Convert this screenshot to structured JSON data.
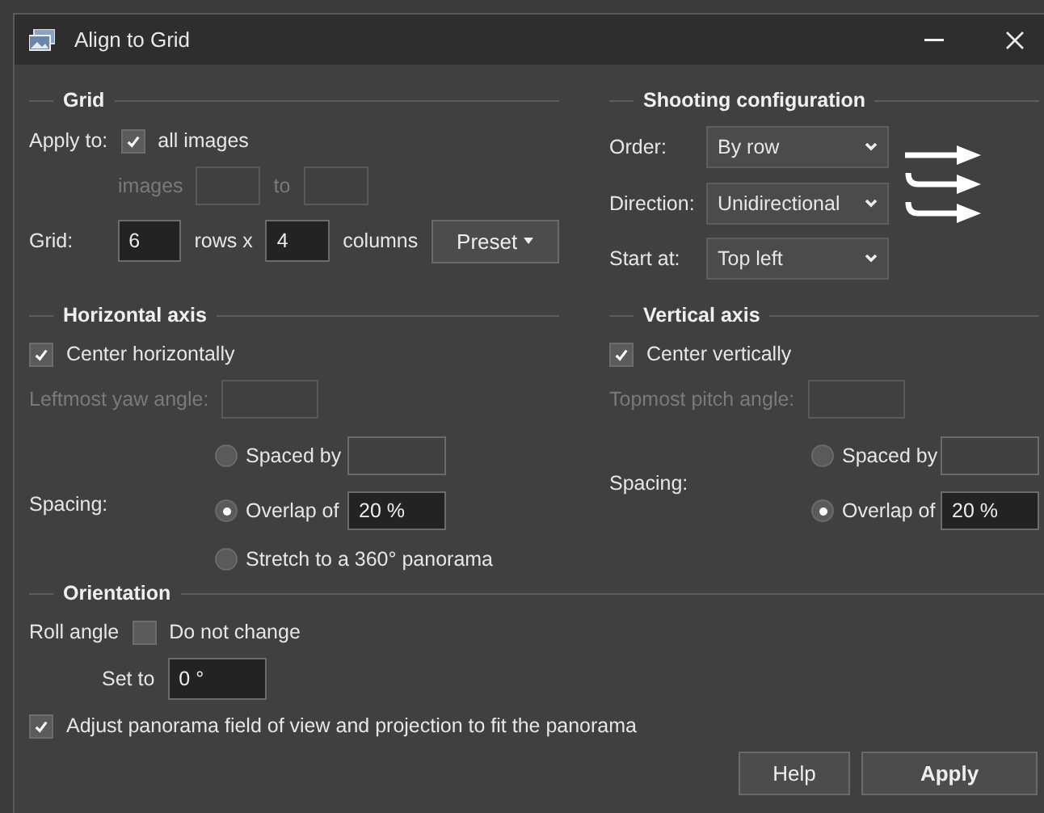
{
  "window": {
    "title": "Align to Grid"
  },
  "grid": {
    "heading": "Grid",
    "apply_label": "Apply to:",
    "all_images": {
      "label": "all images",
      "checked": true
    },
    "range": {
      "label": "images",
      "separator": "to",
      "disabled": true
    },
    "grid_label": "Grid:",
    "rows": "6",
    "rows_label": "rows x",
    "columns": "4",
    "columns_label": "columns",
    "preset": "Preset"
  },
  "shooting": {
    "heading": "Shooting configuration",
    "fields": [
      {
        "label": "Order:",
        "value": "By row"
      },
      {
        "label": "Direction:",
        "value": "Unidirectional"
      },
      {
        "label": "Start at:",
        "value": "Top left"
      }
    ]
  },
  "horizontal": {
    "heading": "Horizontal axis",
    "center": {
      "label": "Center horizontally",
      "checked": true
    },
    "angle": {
      "label": "Leftmost yaw angle:",
      "disabled": true
    },
    "spacing_label": "Spacing:",
    "options": [
      {
        "label": "Spaced by",
        "selected": false,
        "has_field": true
      },
      {
        "label": "Overlap of",
        "selected": true,
        "has_field": true,
        "value": "20 %"
      },
      {
        "label": "Stretch to a 360° panorama",
        "selected": false,
        "has_field": false
      }
    ]
  },
  "vertical": {
    "heading": "Vertical axis",
    "center": {
      "label": "Center vertically",
      "checked": true
    },
    "angle": {
      "label": "Topmost pitch angle:",
      "disabled": true
    },
    "spacing_label": "Spacing:",
    "options": [
      {
        "label": "Spaced by",
        "selected": false,
        "has_field": true
      },
      {
        "label": "Overlap of",
        "selected": true,
        "has_field": true,
        "value": "20 %"
      }
    ]
  },
  "orientation": {
    "heading": "Orientation",
    "roll_label": "Roll angle",
    "do_not_change": {
      "label": "Do not change",
      "checked": false
    },
    "set_to_label": "Set to",
    "set_to_value": "0 °"
  },
  "adjust": {
    "label": "Adjust panorama field of view and projection to fit the panorama",
    "checked": true
  },
  "buttons": [
    {
      "label": "Help",
      "default": false
    },
    {
      "label": "Apply",
      "default": true
    }
  ]
}
